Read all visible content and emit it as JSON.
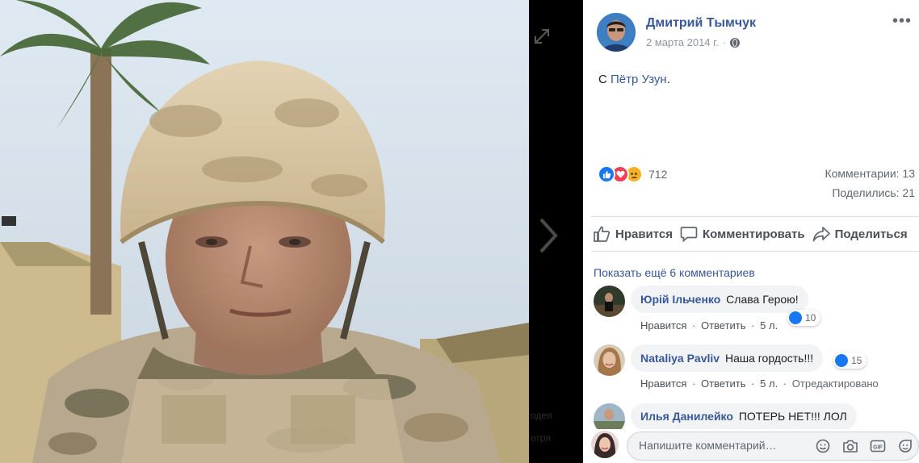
{
  "viewer": {
    "photo_alt": "",
    "shadow_text_1": "одея",
    "shadow_text_2": "отря"
  },
  "post": {
    "author": "Дмитрий Тымчук",
    "date": "2 марта 2014 г.",
    "date_separator": "·",
    "text_prefix": "С",
    "tagged": "Пётр Узун",
    "text_suffix": ".",
    "reactions_count": "712",
    "comments_stat": "Комментарии: 13",
    "shares_stat": "Поделились: 21"
  },
  "actions": {
    "like": "Нравится",
    "comment": "Комментировать",
    "share": "Поделиться"
  },
  "comments_section": {
    "more_link": "Показать ещё 6 комментариев",
    "items": [
      {
        "name": "Юрій Ільченко",
        "text": "Слава Герою!",
        "likes": "10",
        "like_label": "Нравится",
        "reply_label": "Ответить",
        "time": "5 л.",
        "edited": ""
      },
      {
        "name": "Nataliya Pavliv",
        "text": "Наша гордость!!!",
        "likes": "15",
        "like_label": "Нравится",
        "reply_label": "Ответить",
        "time": "5 л.",
        "edited": "Отредактировано"
      },
      {
        "name": "Илья Данилейко",
        "text": "ПОТЕРЬ НЕТ!!! ЛОЛ"
      }
    ]
  },
  "compose": {
    "placeholder": "Напишите комментарий…",
    "icons": [
      "emoji-icon",
      "camera-icon",
      "gif-icon",
      "sticker-icon"
    ]
  },
  "colors": {
    "link": "#385898",
    "like_blue": "#1877f2",
    "love_red": "#f33e58",
    "sad_yellow": "#f7b125"
  }
}
